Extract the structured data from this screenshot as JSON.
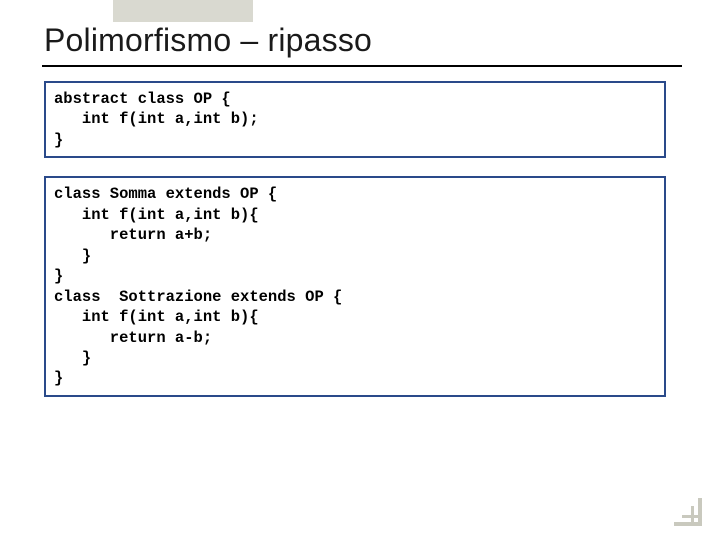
{
  "title": "Polimorfismo –  ripasso",
  "code_blocks": [
    "abstract class OP {\n   int f(int a,int b);\n}",
    "class Somma extends OP {\n   int f(int a,int b){\n      return a+b;\n   }\n}\nclass  Sottrazione extends OP {\n   int f(int a,int b){\n      return a-b;\n   }\n}"
  ]
}
